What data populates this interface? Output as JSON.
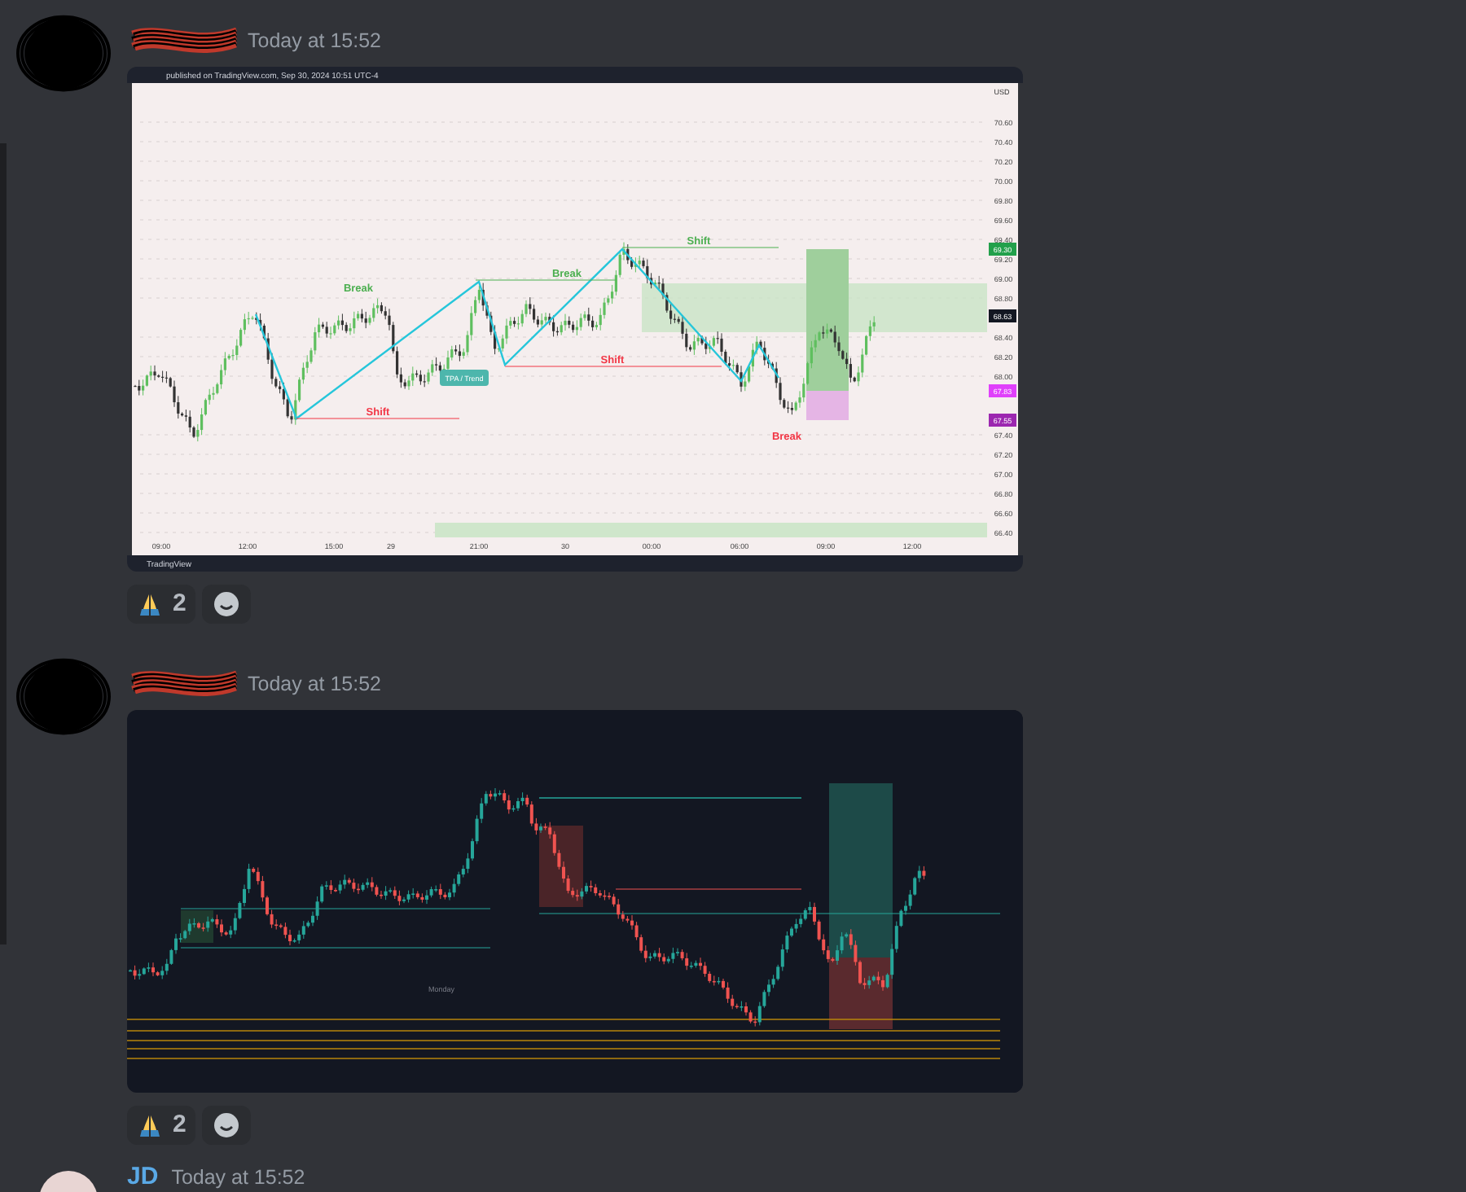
{
  "messages": [
    {
      "timestamp": "Today at 15:52",
      "image": {
        "kind": "light",
        "header": "published on TradingView.com, Sep 30, 2024 10:51 UTC-4",
        "currency": "USD",
        "footer": "TradingView",
        "callout": "TPA / Trend",
        "x_labels": [
          "09:00",
          "12:00",
          "15:00",
          "29",
          "21:00",
          "30",
          "00:00",
          "06:00",
          "09:00",
          "12:00"
        ],
        "y_labels": [
          "70.60",
          "70.40",
          "70.20",
          "70.00",
          "69.80",
          "69.60",
          "69.40",
          "69.20",
          "69.00",
          "68.80",
          "68.40",
          "68.20",
          "68.00",
          "67.40",
          "67.20",
          "67.00",
          "66.80",
          "66.60",
          "66.40"
        ],
        "annotations": [
          {
            "text": "Break",
            "color": "#4caf50"
          },
          {
            "text": "Shift",
            "color": "#f23645"
          },
          {
            "text": "Break",
            "color": "#4caf50"
          },
          {
            "text": "Shift",
            "color": "#4caf50"
          },
          {
            "text": "Shift",
            "color": "#f23645"
          },
          {
            "text": "Break",
            "color": "#f23645"
          }
        ],
        "price_tags": [
          {
            "text": "69.30",
            "color": "#22a04b"
          },
          {
            "text": "68.63",
            "color": "#131722"
          },
          {
            "text": "67.83",
            "color": "#e040fb"
          },
          {
            "text": "67.55",
            "color": "#9c27b0"
          }
        ]
      },
      "reactions": [
        {
          "count": "2"
        }
      ]
    },
    {
      "timestamp": "Today at 15:52",
      "image": {
        "kind": "dark",
        "session_label": "Monday"
      },
      "reactions": [
        {
          "count": "2"
        }
      ]
    },
    {
      "author": "JD",
      "timestamp": "Today at 15:52"
    }
  ]
}
